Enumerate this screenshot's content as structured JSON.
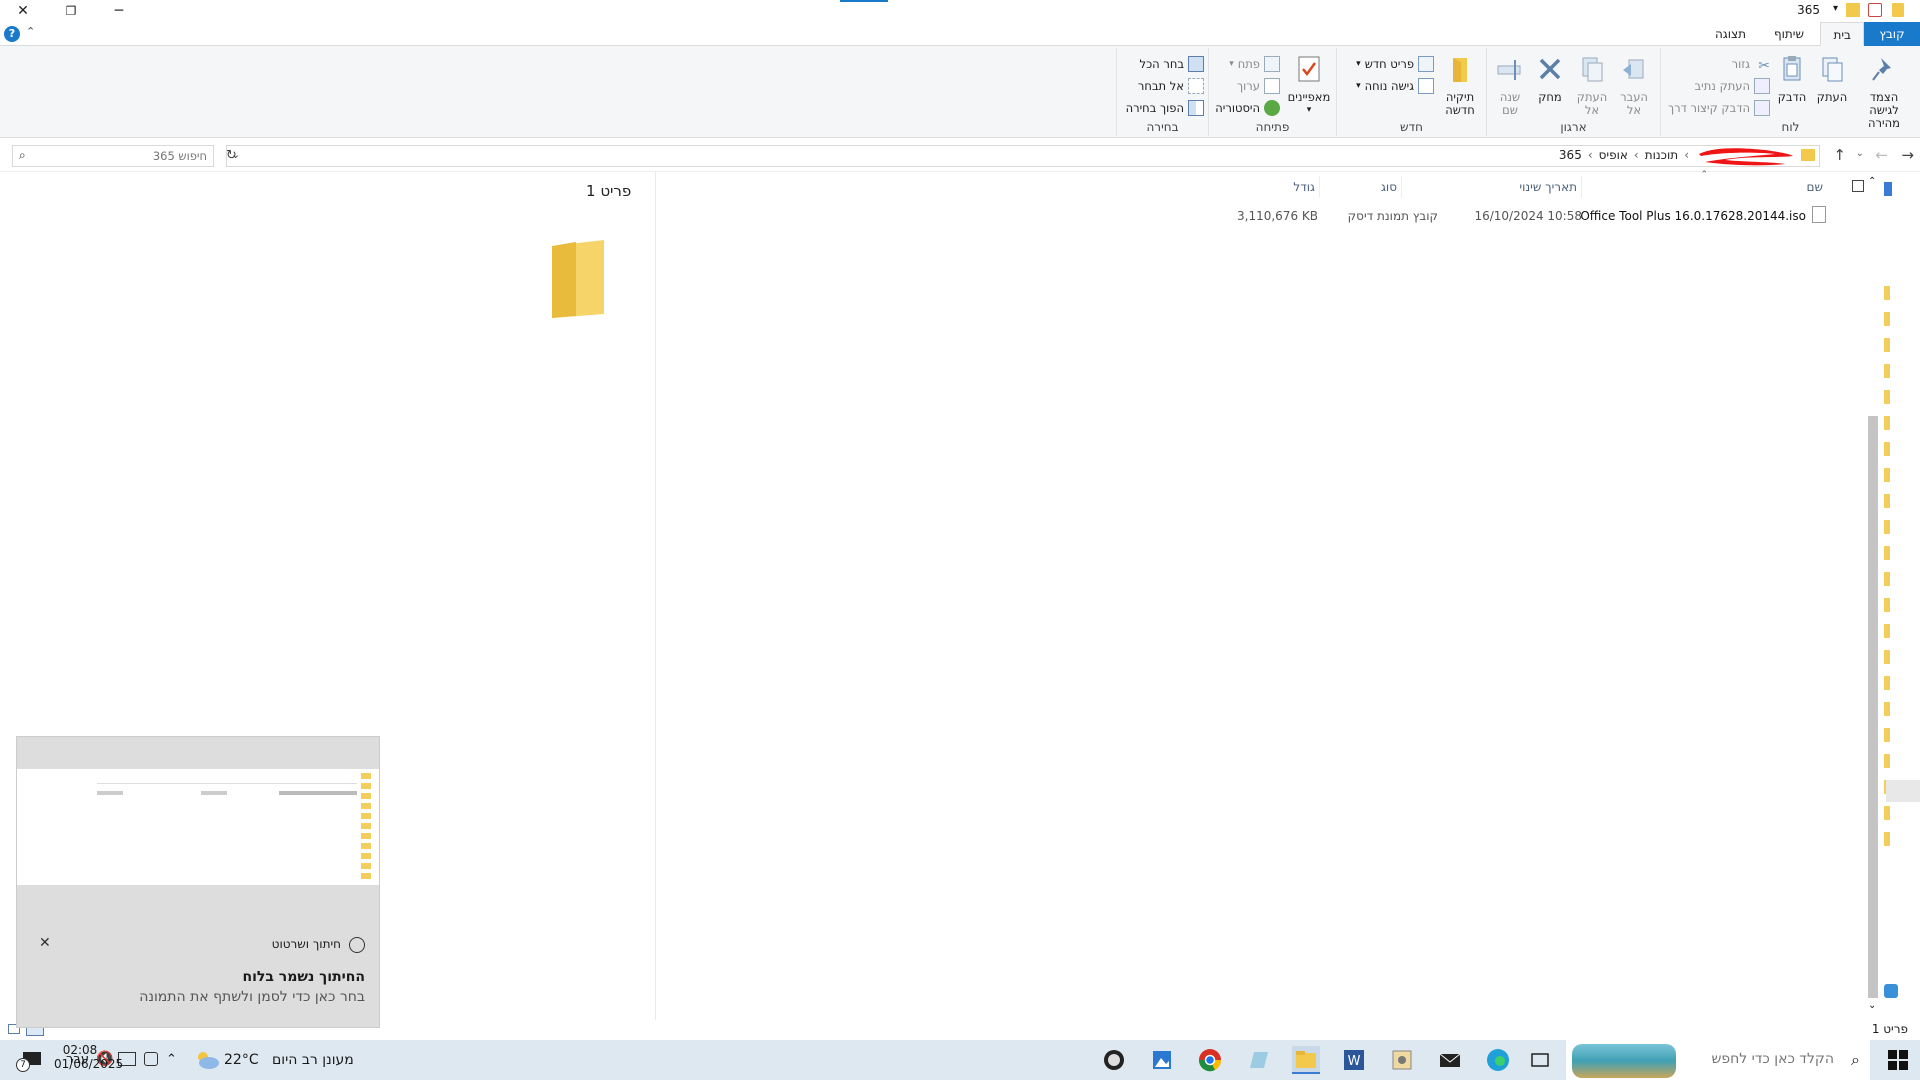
{
  "titlebar": {
    "title": "365"
  },
  "tabs": {
    "file": "קובץ",
    "home": "בית",
    "share": "שיתוף",
    "view": "תצוגה"
  },
  "ribbon": {
    "clipboard": {
      "label": "לוח",
      "pin": "הצמד לגישה\nמהירה",
      "copy": "העתק",
      "paste": "הדבק",
      "cut": "גזור",
      "copy_path": "העתק נתיב",
      "paste_shortcut": "הדבק קיצור דרך"
    },
    "organize": {
      "label": "ארגון",
      "move_to": "העבר\nאל",
      "copy_to": "העתק\nאל",
      "delete": "מחק",
      "rename": "שנה\nשם"
    },
    "new": {
      "label": "חדש",
      "new_folder": "תיקיה\nחדשה",
      "new_item": "פריט חדש",
      "easy_access": "גישה נוחה"
    },
    "open": {
      "label": "פתיחה",
      "properties": "מאפיינים",
      "open": "פתח",
      "edit": "ערוך",
      "history": "היסטוריה"
    },
    "select": {
      "label": "בחירה",
      "select_all": "בחר הכל",
      "select_none": "אל תבחר",
      "invert": "הפוך בחירה"
    }
  },
  "address": {
    "crumbs": [
      "תוכנות",
      "אופיס",
      "365"
    ],
    "search_placeholder": "חיפוש 365"
  },
  "columns": {
    "name": "שם",
    "date": "תאריך שינוי",
    "type": "סוג",
    "size": "גודל"
  },
  "files": [
    {
      "name": "Office Tool Plus 16.0.17628.20144.iso",
      "date": "16/10/2024 10:58",
      "type": "קובץ תמונת דיסק",
      "size": "3,110,676 KB"
    }
  ],
  "details": {
    "count": "פריט 1"
  },
  "status": {
    "count": "פריט 1"
  },
  "toast": {
    "app": "חיתוך ושרטוט",
    "title": "החיתוך נשמר בלוח",
    "body": "בחר כאן כדי לסמן ולשתף את התמונה"
  },
  "taskbar": {
    "search_placeholder": "הקלד כאן כדי לחפש",
    "weather_temp": "22°C",
    "weather_text": "מעונן רב היום",
    "lang": "עבר",
    "time": "02:08",
    "date": "01/06/2025",
    "notif_count": "7"
  }
}
